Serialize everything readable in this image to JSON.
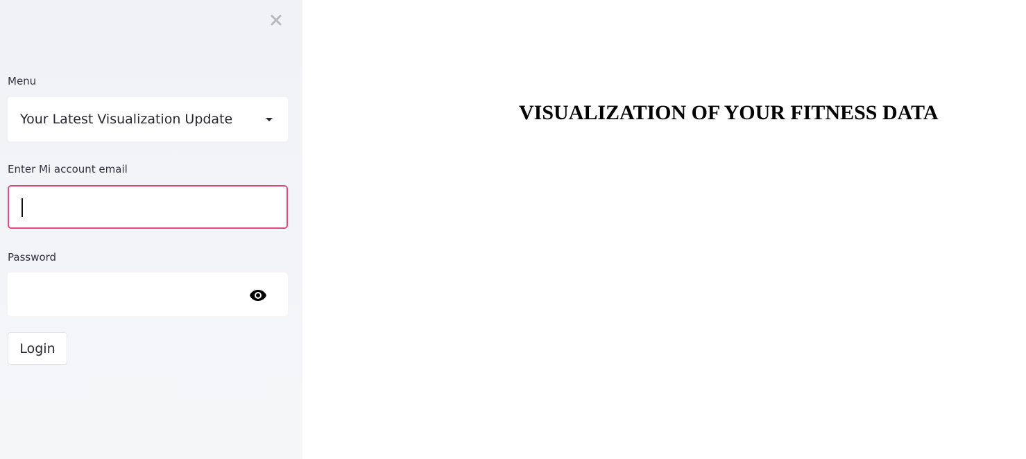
{
  "sidebar": {
    "close_icon": "close-icon",
    "menu": {
      "label": "Menu",
      "selected": "Your Latest Visualization Update"
    },
    "email": {
      "label": "Enter Mi account email",
      "value": "",
      "placeholder": ""
    },
    "password": {
      "label": "Password",
      "value": "",
      "placeholder": "",
      "toggle_icon": "eye-icon"
    },
    "login_label": "Login"
  },
  "main": {
    "title": "VISUALIZATION OF YOUR FITNESS DATA"
  },
  "colors": {
    "sidebar_bg": "#f0f2f6",
    "focus_border": "#e0497a",
    "text": "#31333f"
  }
}
